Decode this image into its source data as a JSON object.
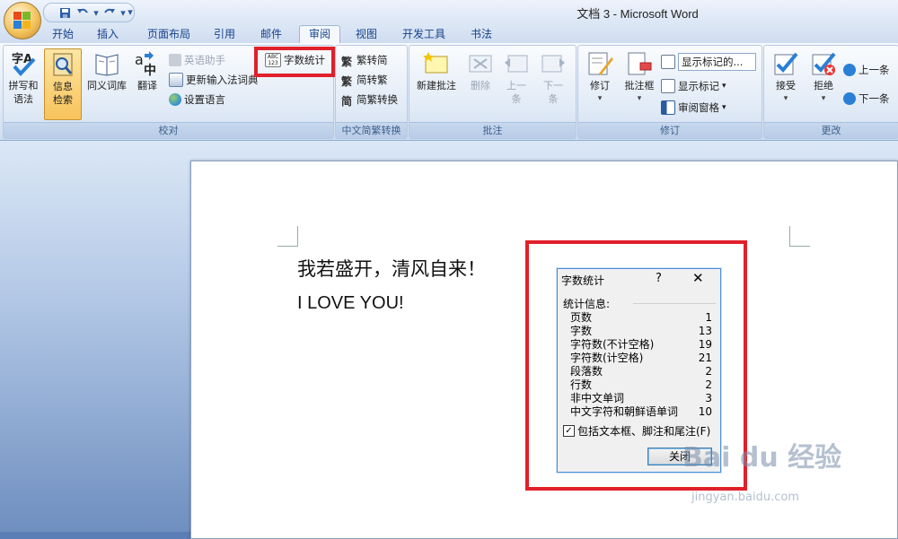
{
  "window": {
    "title": "文档 3 - Microsoft Word"
  },
  "qat": {
    "save_icon": "save-icon",
    "undo_icon": "undo-icon",
    "redo_icon": "redo-icon",
    "customize": "▾"
  },
  "tabs": [
    {
      "label": "开始"
    },
    {
      "label": "插入"
    },
    {
      "label": "页面布局"
    },
    {
      "label": "引用"
    },
    {
      "label": "邮件"
    },
    {
      "label": "审阅",
      "active": true
    },
    {
      "label": "视图"
    },
    {
      "label": "开发工具"
    },
    {
      "label": "书法"
    }
  ],
  "ribbon": {
    "proofing": {
      "label": "校对",
      "spelling": "拼写和\n语法",
      "research": "信息\n检索",
      "thesaurus": "同义词库",
      "translate": "翻译",
      "english_assistant": "英语助手",
      "update_ime": "更新输入法词典",
      "set_language": "设置语言",
      "word_count": "字数统计"
    },
    "chinese_conversion": {
      "label": "中文简繁转换",
      "to_simplified": "繁转简",
      "to_traditional": "简转繁",
      "convert": "简繁转换"
    },
    "comments": {
      "label": "批注",
      "new": "新建批注",
      "delete": "删除",
      "previous": "上一\n条",
      "next": "下一\n条"
    },
    "tracking": {
      "label": "修订",
      "track_changes": "修订",
      "balloons": "批注框",
      "display": "显示标记的...",
      "show_markup": "显示标记",
      "reviewing_pane": "审阅窗格"
    },
    "changes": {
      "label": "更改",
      "accept": "接受",
      "reject": "拒绝",
      "previous": "上一条",
      "next": "下一条"
    }
  },
  "document": {
    "line1": "我若盛开，清风自来！",
    "line2": "I LOVE YOU!"
  },
  "dialog": {
    "title": "字数统计",
    "help": "?",
    "close_x": "✕",
    "section": "统计信息:",
    "stats": [
      {
        "label": "页数",
        "value": "1"
      },
      {
        "label": "字数",
        "value": "13"
      },
      {
        "label": "字符数(不计空格)",
        "value": "19"
      },
      {
        "label": "字符数(计空格)",
        "value": "21"
      },
      {
        "label": "段落数",
        "value": "2"
      },
      {
        "label": "行数",
        "value": "2"
      },
      {
        "label": "非中文单词",
        "value": "3"
      },
      {
        "label": "中文字符和朝鲜语单词",
        "value": "10"
      }
    ],
    "include_checkbox": {
      "label": "包括文本框、脚注和尾注(F)",
      "checked": true
    },
    "close_button": "关闭"
  },
  "watermark": {
    "main": "Bai du 经验",
    "sub": "jingyan.baidu.com"
  },
  "colors": {
    "highlight": "#e0202a",
    "ribbon_text": "#15428b"
  }
}
